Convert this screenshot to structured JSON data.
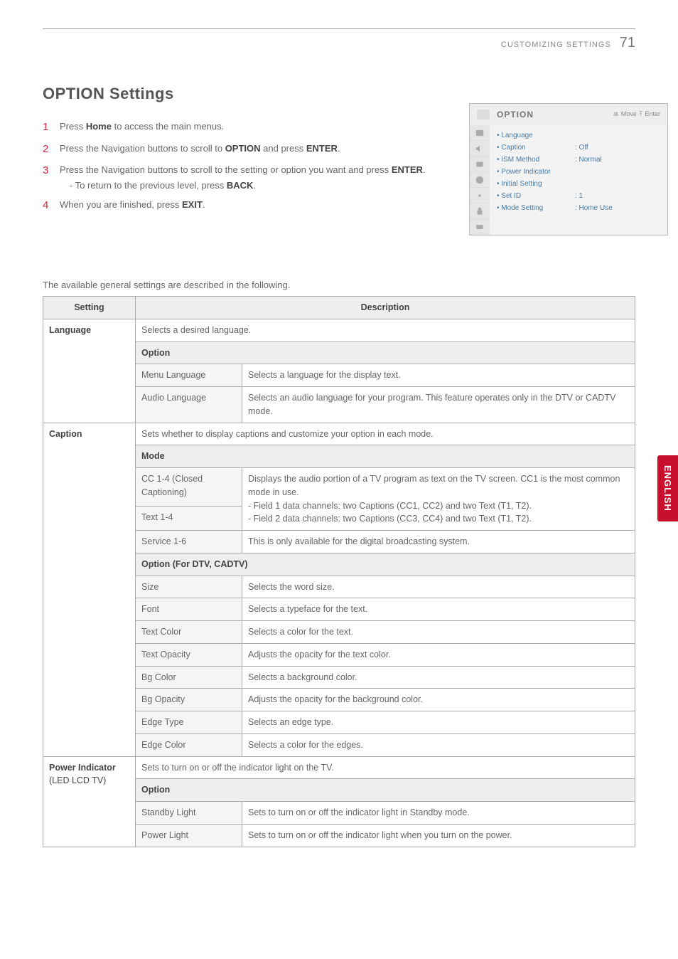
{
  "header": {
    "section": "CUSTOMIZING SETTINGS",
    "page": "71"
  },
  "title": "OPTION Settings",
  "steps": {
    "s1": {
      "num": "1",
      "pre": "Press ",
      "b": "Home",
      "post": " to access the main menus."
    },
    "s2": {
      "num": "2",
      "pre": "Press the Navigation buttons to scroll to ",
      "b1": "OPTION",
      "mid": " and press ",
      "b2": "ENTER",
      "post": "."
    },
    "s3": {
      "num": "3",
      "pre": "Press the Navigation buttons to scroll to the setting or option you want and press ",
      "b": "ENTER",
      "post": ".",
      "sub_pre": "- To return to the previous level, press ",
      "sub_b": "BACK",
      "sub_post": "."
    },
    "s4": {
      "num": "4",
      "pre": "When you are finished, press ",
      "b": "EXIT",
      "post": "."
    }
  },
  "osd": {
    "title": "OPTION",
    "right": "ꔛ Move   ꔉ Enter",
    "rows": [
      {
        "label": "• Language",
        "value": ""
      },
      {
        "label": "• Caption",
        "value": ": Off"
      },
      {
        "label": "• ISM Method",
        "value": ": Normal"
      },
      {
        "label": "• Power Indicator",
        "value": ""
      },
      {
        "label": "• Initial Setting",
        "value": ""
      },
      {
        "label": "• Set ID",
        "value": ": 1"
      },
      {
        "label": "• Mode Setting",
        "value": ": Home Use"
      }
    ]
  },
  "table_intro": "The available general settings are described in the following.",
  "theaders": {
    "setting": "Setting",
    "desc": "Description"
  },
  "rows": {
    "language": {
      "name": "Language",
      "desc": "Selects a desired language.",
      "subhead": "Option",
      "menu_lang": "Menu Language",
      "menu_lang_d": "Selects a language for the display text.",
      "audio_lang": "Audio Language",
      "audio_lang_d": "Selects an audio language for your program. This feature operates only in the DTV or CADTV mode."
    },
    "caption": {
      "name": "Caption",
      "desc": "Sets whether to display captions and customize your option in each mode.",
      "subhead1": "Mode",
      "cc": "CC 1-4 (Closed Captioning)",
      "cc_d1": "Displays the audio portion of a TV program as text on the TV screen. CC1 is the most common mode in use.",
      "text14": "Text 1-4",
      "cc_d2": "- Field 1 data channels: two Captions (CC1, CC2) and two Text (T1, T2).\n- Field 2 data channels: two Captions (CC3, CC4) and two Text (T1, T2).",
      "service": "Service 1-6",
      "service_d": "This is only available for the digital broadcasting system.",
      "subhead2_b": "Option",
      "subhead2_rest": " (For DTV, CADTV)",
      "size": "Size",
      "size_d": "Selects the word size.",
      "font": "Font",
      "font_d": "Selects a typeface for the text.",
      "tcolor": "Text Color",
      "tcolor_d": "Selects a color for the text.",
      "topac": "Text Opacity",
      "topac_d": "Adjusts the opacity for the text color.",
      "bgcolor": "Bg Color",
      "bgcolor_d": "Selects a background color.",
      "bgopac": "Bg Opacity",
      "bgopac_d": "Adjusts the opacity for the background color.",
      "edget": "Edge Type",
      "edget_d": "Selects an edge type.",
      "edgec": "Edge Color",
      "edgec_d": "Selects a color for the edges."
    },
    "power": {
      "name": "Power Indicator",
      "note": "(LED LCD TV)",
      "desc": "Sets to turn on or off the indicator light on the TV.",
      "subhead": "Option",
      "standby": "Standby Light",
      "standby_d": "Sets to turn on or off the indicator light in Standby mode.",
      "plight": "Power Light",
      "plight_d": "Sets to turn on or off the indicator light when you turn on the power."
    }
  },
  "side_tab": "ENGLISH"
}
